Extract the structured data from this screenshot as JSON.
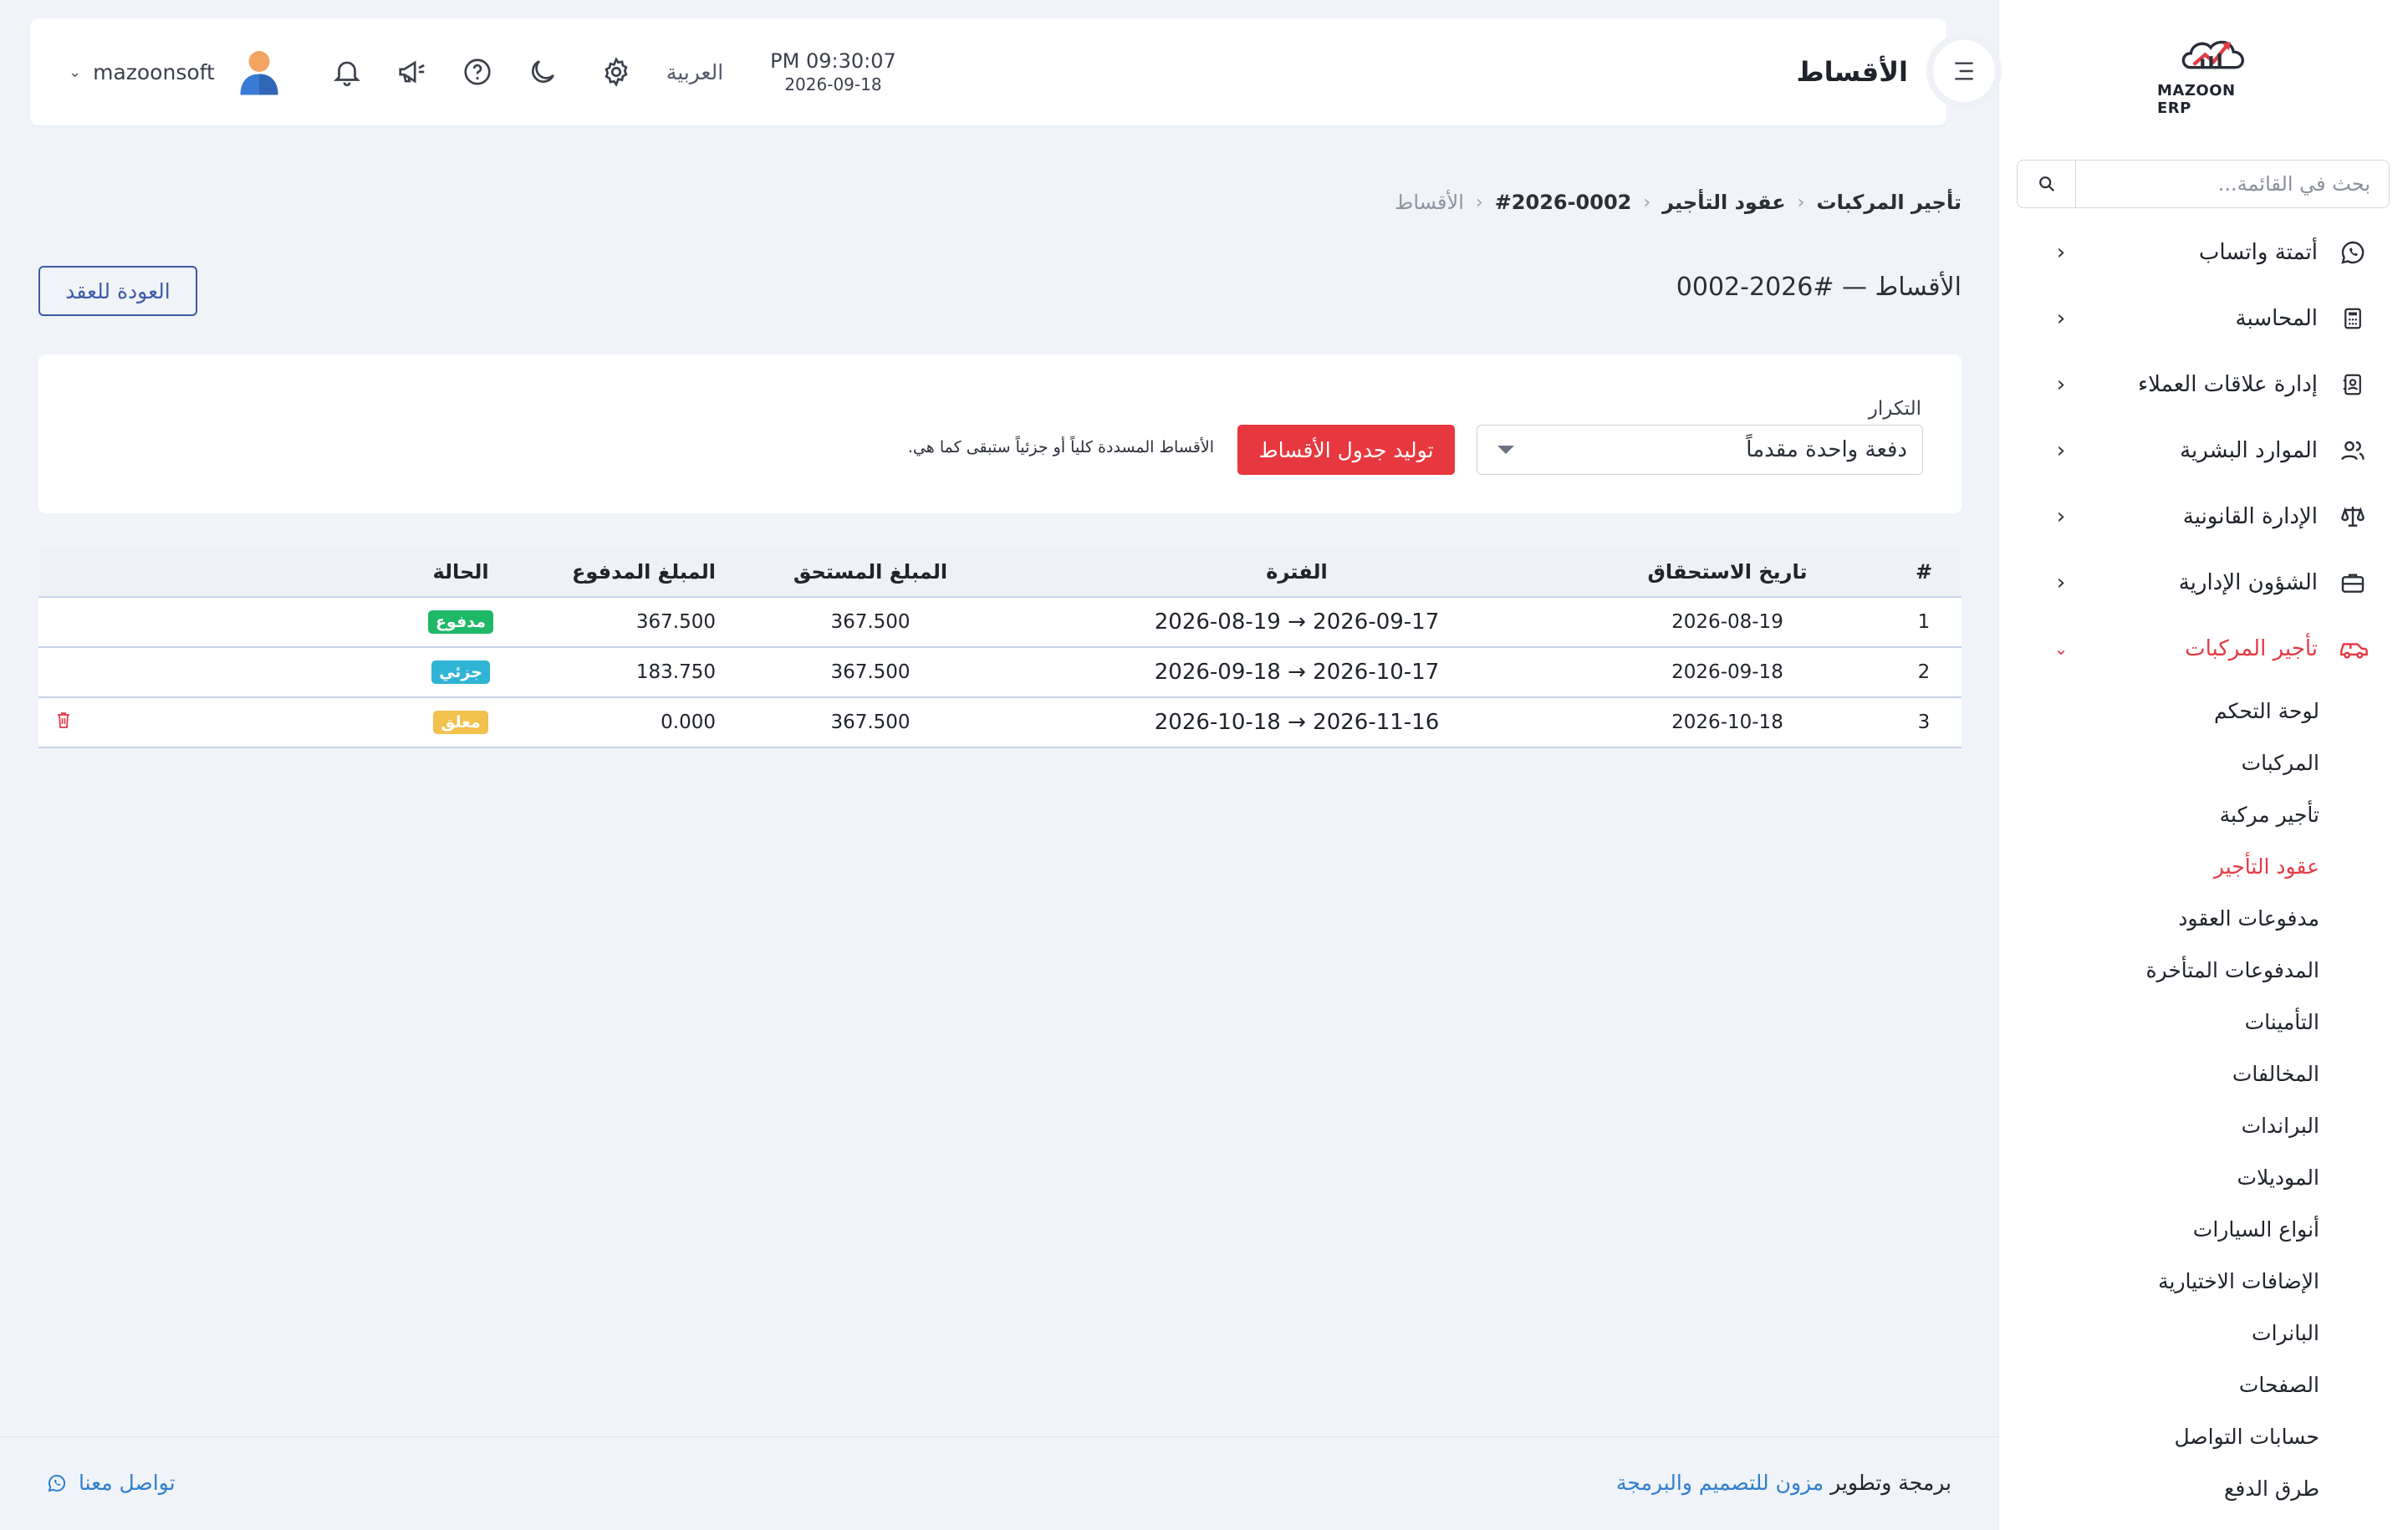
{
  "brand": {
    "logo_text": "MAZOON ERP"
  },
  "sidebar": {
    "search_placeholder": "بحث في القائمة...",
    "items": [
      {
        "label": "أتمتة واتساب",
        "icon": "whatsapp-icon"
      },
      {
        "label": "المحاسبة",
        "icon": "calculator-icon"
      },
      {
        "label": "إدارة علاقات العملاء",
        "icon": "contacts-icon"
      },
      {
        "label": "الموارد البشرية",
        "icon": "users-icon"
      },
      {
        "label": "الإدارة القانونية",
        "icon": "scale-icon"
      },
      {
        "label": "الشؤون الإدارية",
        "icon": "briefcase-icon"
      },
      {
        "label": "تأجير المركبات",
        "icon": "car-icon",
        "active": true
      }
    ],
    "sub_items": [
      "لوحة التحكم",
      "المركبات",
      "تأجير مركبة",
      "عقود التأجير",
      "مدفوعات العقود",
      "المدفوعات المتأخرة",
      "التأمينات",
      "المخالفات",
      "البراندات",
      "الموديلات",
      "أنواع السيارات",
      "الإضافات الاختيارية",
      "البانرات",
      "الصفحات",
      "حسابات التواصل",
      "طرق الدفع"
    ],
    "active_sub_index": 3
  },
  "header": {
    "title": "الأقساط",
    "time": "PM 09:30:07",
    "date": "2026-09-18",
    "language": "العربية",
    "username": "mazoonsoft"
  },
  "breadcrumb": [
    "تأجير المركبات",
    "عقود التأجير",
    "#2026-0002",
    "الأقساط"
  ],
  "page": {
    "title": "الأقساط — #2026-0002",
    "back_label": "العودة للعقد"
  },
  "schedule_form": {
    "frequency_label": "التكرار",
    "frequency_value": "دفعة واحدة مقدماً",
    "generate_label": "توليد جدول الأقساط",
    "note": "الأقساط المسددة كلياً أو جزئياً ستبقى كما هي."
  },
  "table": {
    "headers": [
      "#",
      "تاريخ الاستحقاق",
      "الفترة",
      "المبلغ المستحق",
      "المبلغ المدفوع",
      "الحالة"
    ],
    "rows": [
      {
        "num": "1",
        "due_date": "2026-08-19",
        "period": "2026-08-19 → 2026-09-17",
        "amount_due": "367.500",
        "amount_paid": "367.500",
        "status": "مدفوع",
        "status_color": "#1fb866",
        "deletable": false
      },
      {
        "num": "2",
        "due_date": "2026-09-18",
        "period": "2026-09-18 → 2026-10-17",
        "amount_due": "367.500",
        "amount_paid": "183.750",
        "status": "جزئي",
        "status_color": "#2fb4d6",
        "deletable": false
      },
      {
        "num": "3",
        "due_date": "2026-10-18",
        "period": "2026-10-18 → 2026-11-16",
        "amount_due": "367.500",
        "amount_paid": "0.000",
        "status": "معلق",
        "status_color": "#f2c14e",
        "deletable": true
      }
    ]
  },
  "footer": {
    "prefix": "برمجة وتطوير",
    "company": "مزون للتصميم والبرمجة",
    "contact": "تواصل معنا"
  },
  "colors": {
    "accent": "#e33b45",
    "primary": "#3d5ba8",
    "link": "#2f7fd1"
  }
}
